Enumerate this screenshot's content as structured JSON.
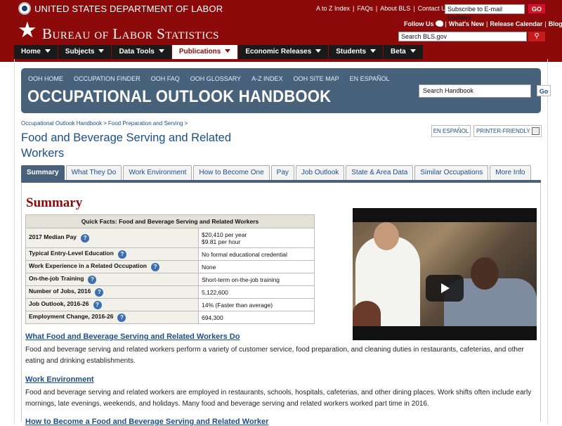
{
  "header": {
    "dol_title": "UNITED STATES DEPARTMENT OF LABOR",
    "util_links": [
      "A to Z Index",
      "FAQs",
      "About BLS",
      "Contact Us"
    ],
    "email_placeholder": "Subscribe to E-mail Updates",
    "go_label": "GO",
    "bls_title": "Bureau of Labor Statistics",
    "secondary_links": [
      "Follow Us",
      "What's New",
      "Release Calendar",
      "Blog"
    ],
    "search_placeholder": "Search BLS.gov",
    "brand_color": "#8c0a0a"
  },
  "nav": {
    "items": [
      {
        "label": "Home",
        "active": false
      },
      {
        "label": "Subjects",
        "active": false
      },
      {
        "label": "Data Tools",
        "active": false
      },
      {
        "label": "Publications",
        "active": true
      },
      {
        "label": "Economic Releases",
        "active": false
      },
      {
        "label": "Students",
        "active": false
      },
      {
        "label": "Beta",
        "active": false
      }
    ]
  },
  "ooh": {
    "links": [
      "OOH HOME",
      "OCCUPATION FINDER",
      "OOH FAQ",
      "OOH GLOSSARY",
      "A-Z INDEX",
      "OOH SITE MAP",
      "EN ESPAÑOL"
    ],
    "title": "OCCUPATIONAL OUTLOOK HANDBOOK",
    "search_placeholder": "Search Handbook",
    "go_label": "Go",
    "banner_color": "#48627c"
  },
  "page": {
    "breadcrumb": [
      "Occupational Outlook Handbook",
      "Food Preparation and Serving"
    ],
    "title": "Food and Beverage Serving and Related Workers",
    "lang_label": "EN ESPAÑOL",
    "print_label": "PRINTER-FRIENDLY"
  },
  "tabs": [
    "Summary",
    "What They Do",
    "Work Environment",
    "How to Become One",
    "Pay",
    "Job Outlook",
    "State & Area Data",
    "Similar Occupations",
    "More Info"
  ],
  "summary": {
    "heading": "Summary",
    "table_title": "Quick Facts: Food and Beverage Serving and Related Workers",
    "rows": [
      {
        "label": "2017 Median Pay",
        "value": "$20,410 per year",
        "value2": "$9.81 per hour"
      },
      {
        "label": "Typical Entry-Level Education",
        "value": "No formal educational credential"
      },
      {
        "label": "Work Experience in a Related Occupation",
        "value": "None"
      },
      {
        "label": "On-the-job Training",
        "value": "Short-term on-the-job training"
      },
      {
        "label": "Number of Jobs, 2016",
        "value": "5,122,600"
      },
      {
        "label": "Job Outlook, 2016-26",
        "value": "14% (Faster than average)"
      },
      {
        "label": "Employment Change, 2016-26",
        "value": "694,300"
      }
    ]
  },
  "sections": [
    {
      "heading": "What Food and Beverage Serving and Related Workers Do",
      "text": "Food and beverage serving and related workers perform a variety of customer service, food preparation, and cleaning duties in restaurants, cafeterias, and other eating and drinking establishments."
    },
    {
      "heading": "Work Environment",
      "text": "Food and beverage serving and related workers are employed in restaurants, schools, hospitals, cafeterias, and other dining places. Work shifts often include early mornings, late evenings, weekends, and holidays. Many food and beverage serving and related workers worked part time in 2016."
    },
    {
      "heading": "How to Become a Food and Beverage Serving and Related Worker",
      "text": ""
    }
  ]
}
